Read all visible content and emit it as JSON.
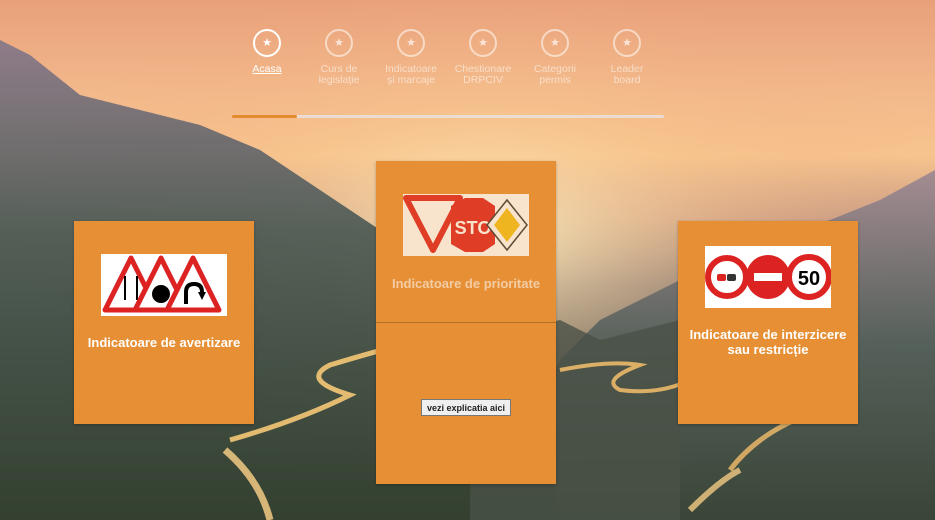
{
  "nav": {
    "items": [
      {
        "label": "Acasa",
        "icon": "star-icon"
      },
      {
        "label": "Curs de\nlegislație",
        "icon": "star-icon"
      },
      {
        "label": "Indicatoare\nși marcaje",
        "icon": "star-icon"
      },
      {
        "label": "Chestionare\nDRPCIV",
        "icon": "star-icon"
      },
      {
        "label": "Categorii\npermis",
        "icon": "star-icon"
      },
      {
        "label": "Leader\nboard",
        "icon": "star-icon"
      }
    ],
    "active_index": 0,
    "progress_fraction": 0.15
  },
  "cards": {
    "left": {
      "title": "Indicatoare de avertizare"
    },
    "center": {
      "title": "Indicatoare de prioritate",
      "button_label": "vezi explicatia aici",
      "stop_sign_text": "STO"
    },
    "right": {
      "title": "Indicatoare de interzicere sau restricție",
      "speed_limit_text": "50"
    }
  },
  "colors": {
    "card_orange": "#e68f35",
    "progress_orange": "#e58b2f"
  }
}
